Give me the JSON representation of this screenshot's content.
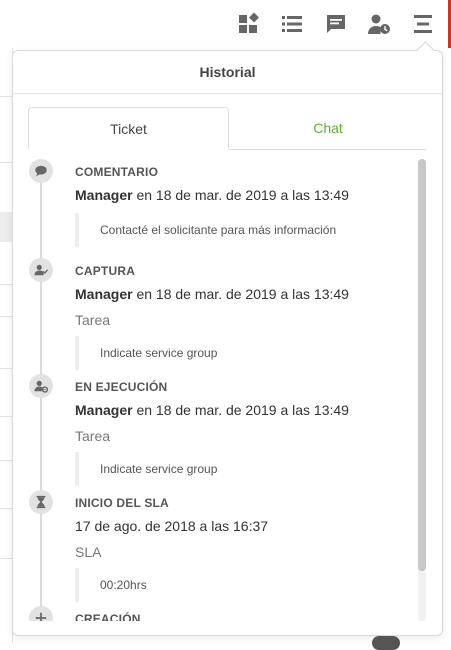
{
  "toolbar": {
    "icons": [
      "widgets-icon",
      "list-icon",
      "chat-icon",
      "user-clock-icon",
      "menu-icon"
    ]
  },
  "popover": {
    "title": "Historial",
    "tabs": [
      {
        "label": "Ticket",
        "active": true
      },
      {
        "label": "Chat",
        "active": false
      }
    ]
  },
  "events": [
    {
      "icon": "comment-icon",
      "type": "COMENTARIO",
      "author": "Manager",
      "when": "en 18 de mar. de 2019 a las 13:49",
      "sub": "",
      "note": "Contacté el solicitante para más información"
    },
    {
      "icon": "user-check-icon",
      "type": "CAPTURA",
      "author": "Manager",
      "when": "en 18 de mar. de 2019 a las 13:49",
      "sub": "Tarea",
      "note": "Indicate service group"
    },
    {
      "icon": "user-gear-icon",
      "type": "EN EJECUCIÓN",
      "author": "Manager",
      "when": "en 18 de mar. de 2019 a las 13:49",
      "sub": "Tarea",
      "note": "Indicate service group"
    },
    {
      "icon": "hourglass-icon",
      "type": "INICIO DEL SLA",
      "author": "",
      "when": "17 de ago. de 2018 a las 16:37",
      "sub": "SLA",
      "note": "00:20hrs"
    },
    {
      "icon": "plus-icon",
      "type": "CREACIÓN",
      "author": "",
      "when": "",
      "sub": "",
      "note": ""
    }
  ],
  "colors": {
    "accent_green": "#5cb130",
    "icon_gray": "#666666",
    "timeline_gray": "#dadada"
  }
}
